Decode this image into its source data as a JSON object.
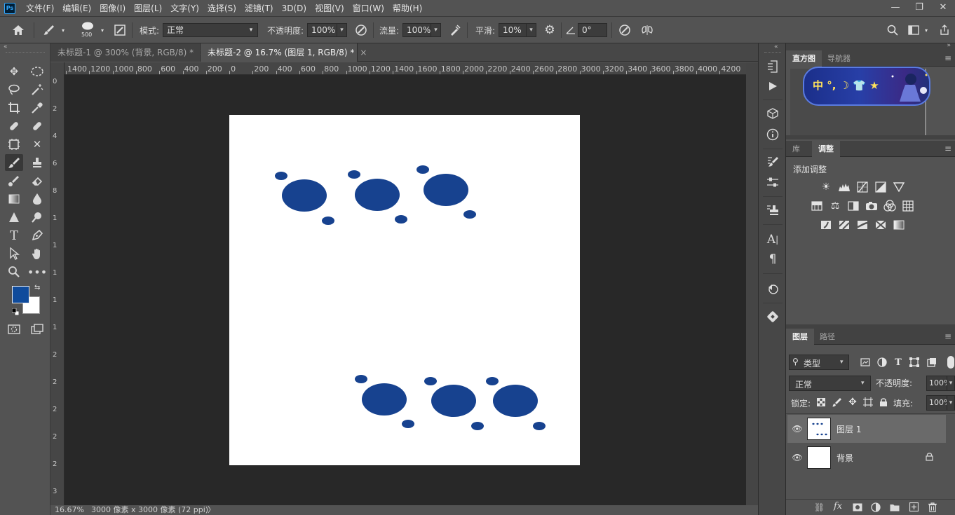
{
  "app": {
    "logo": "Ps"
  },
  "menu": [
    "文件(F)",
    "编辑(E)",
    "图像(I)",
    "图层(L)",
    "文字(Y)",
    "选择(S)",
    "滤镜(T)",
    "3D(D)",
    "视图(V)",
    "窗口(W)",
    "帮助(H)"
  ],
  "window_controls": {
    "minimize": "—",
    "restore": "❐",
    "close": "✕"
  },
  "options": {
    "brush_size": "500",
    "mode_label": "模式:",
    "mode_value": "正常",
    "opacity_label": "不透明度:",
    "opacity_value": "100%",
    "flow_label": "流量:",
    "flow_value": "100%",
    "smoothing_label": "平滑:",
    "smoothing_value": "10%",
    "angle_value": "0°"
  },
  "tabs": [
    {
      "label": "未标题-1 @ 300% (背景, RGB/8) *",
      "close": "×"
    },
    {
      "label": "未标题-2 @ 16.7% (图层 1, RGB/8) *",
      "close": "×"
    }
  ],
  "ruler": {
    "h_ticks": [
      "1400",
      "1200",
      "1000",
      "800",
      "600",
      "400",
      "200",
      "0",
      "200",
      "400",
      "600",
      "800",
      "1000",
      "1200",
      "1400",
      "1600",
      "1800",
      "2000",
      "2200",
      "2400",
      "2600",
      "2800",
      "3000",
      "3200",
      "3400",
      "3600",
      "3800",
      "4000",
      "4200"
    ],
    "v_ticks": [
      "0",
      "2",
      "4",
      "6",
      "8",
      "1",
      "1",
      "1",
      "1",
      "1",
      "2",
      "2",
      "2",
      "2",
      "2",
      "3"
    ]
  },
  "colors": {
    "foreground": "#0f4b9c",
    "background": "#ffffff",
    "dots": "#17428f",
    "workspace": "#282828"
  },
  "status": {
    "zoom": "16.67%",
    "doc_info": "3000 像素 x 3000 像素 (72 ppi)",
    "arrow": "〉"
  },
  "panels": {
    "histogram_tab": "直方图",
    "navigator_tab": "导航器",
    "navigator_overlay": "中 °, ☽ 👕 ★",
    "library_tab": "库",
    "adjust_tab": "调整",
    "add_adjust": "添加调整",
    "layers_tab": "图层",
    "paths_tab": "路径",
    "filter_kind": "类型",
    "blend_mode": "正常",
    "layer_opacity_label": "不透明度:",
    "layer_opacity_value": "100%",
    "lock_label": "锁定:",
    "fill_label": "填充:",
    "fill_value": "100%"
  },
  "layers": [
    {
      "name": "图层 1",
      "selected": true
    },
    {
      "name": "背景",
      "selected": false
    }
  ]
}
